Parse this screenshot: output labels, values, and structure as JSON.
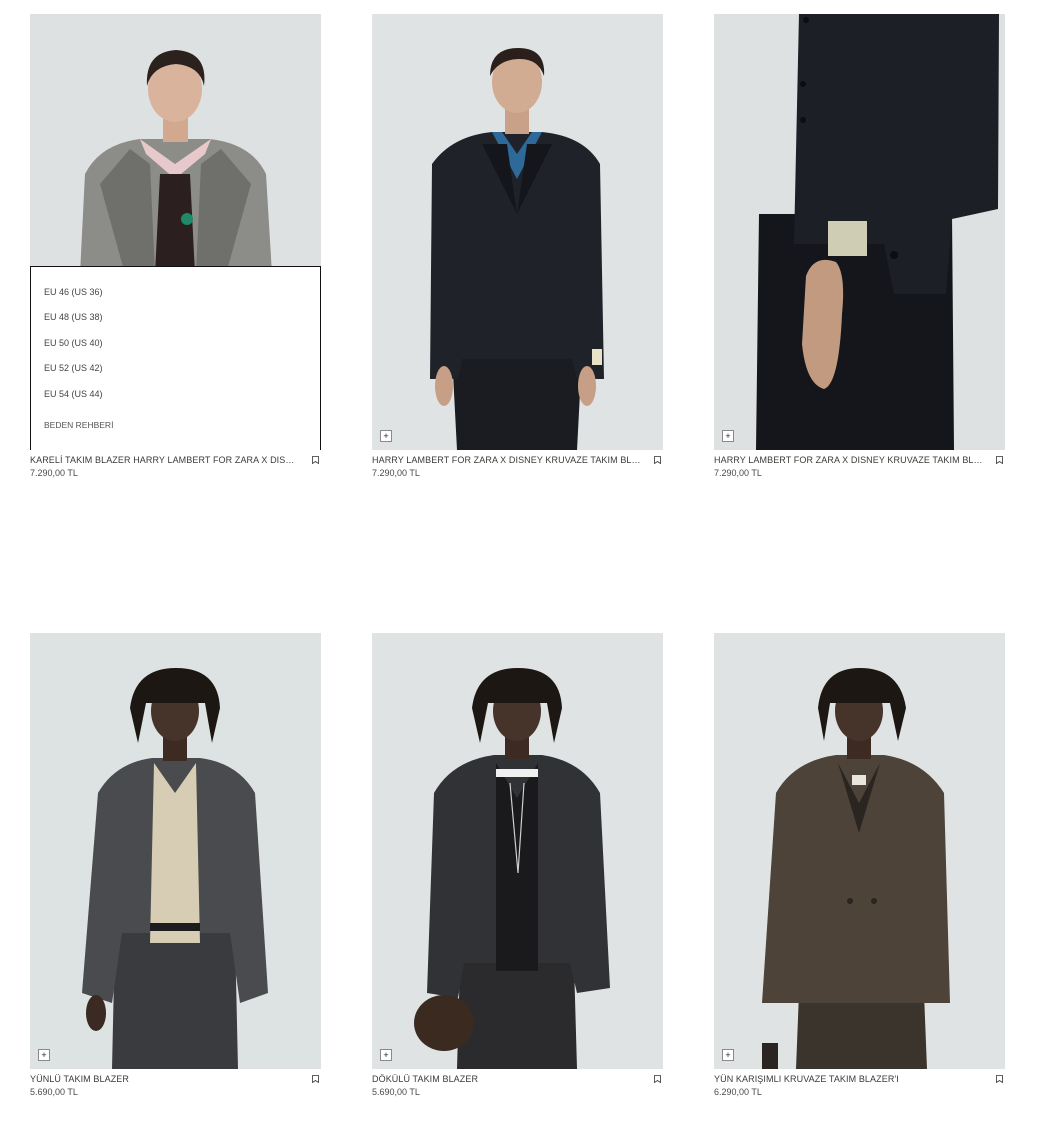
{
  "products": [
    {
      "name": "KARELİ TAKIM BLAZER HARRY LAMBERT FOR ZARA X DISNEY",
      "price": "7.290,00 TL"
    },
    {
      "name": "HARRY LAMBERT FOR ZARA X DISNEY KRUVAZE TAKIM BLAZ...",
      "price": "7.290,00 TL"
    },
    {
      "name": "HARRY LAMBERT FOR ZARA X DISNEY KRUVAZE TAKIM BLAZ...",
      "price": "7.290,00 TL"
    },
    {
      "name": "YÜNLÜ TAKIM BLAZER",
      "price": "5.690,00 TL"
    },
    {
      "name": "DÖKÜLÜ TAKIM BLAZER",
      "price": "5.690,00 TL"
    },
    {
      "name": "YÜN KARIŞIMLI KRUVAZE TAKIM BLAZER'I",
      "price": "6.290,00 TL"
    }
  ],
  "size_panel": {
    "sizes": [
      "EU 46 (US 36)",
      "EU 48 (US 38)",
      "EU 50 (US 40)",
      "EU 52 (US 42)",
      "EU 54 (US 44)"
    ],
    "guide_label": "BEDEN REHBERİ"
  },
  "icons": {
    "add": "plus-icon",
    "save": "bookmark-icon"
  },
  "add_symbol": "+"
}
